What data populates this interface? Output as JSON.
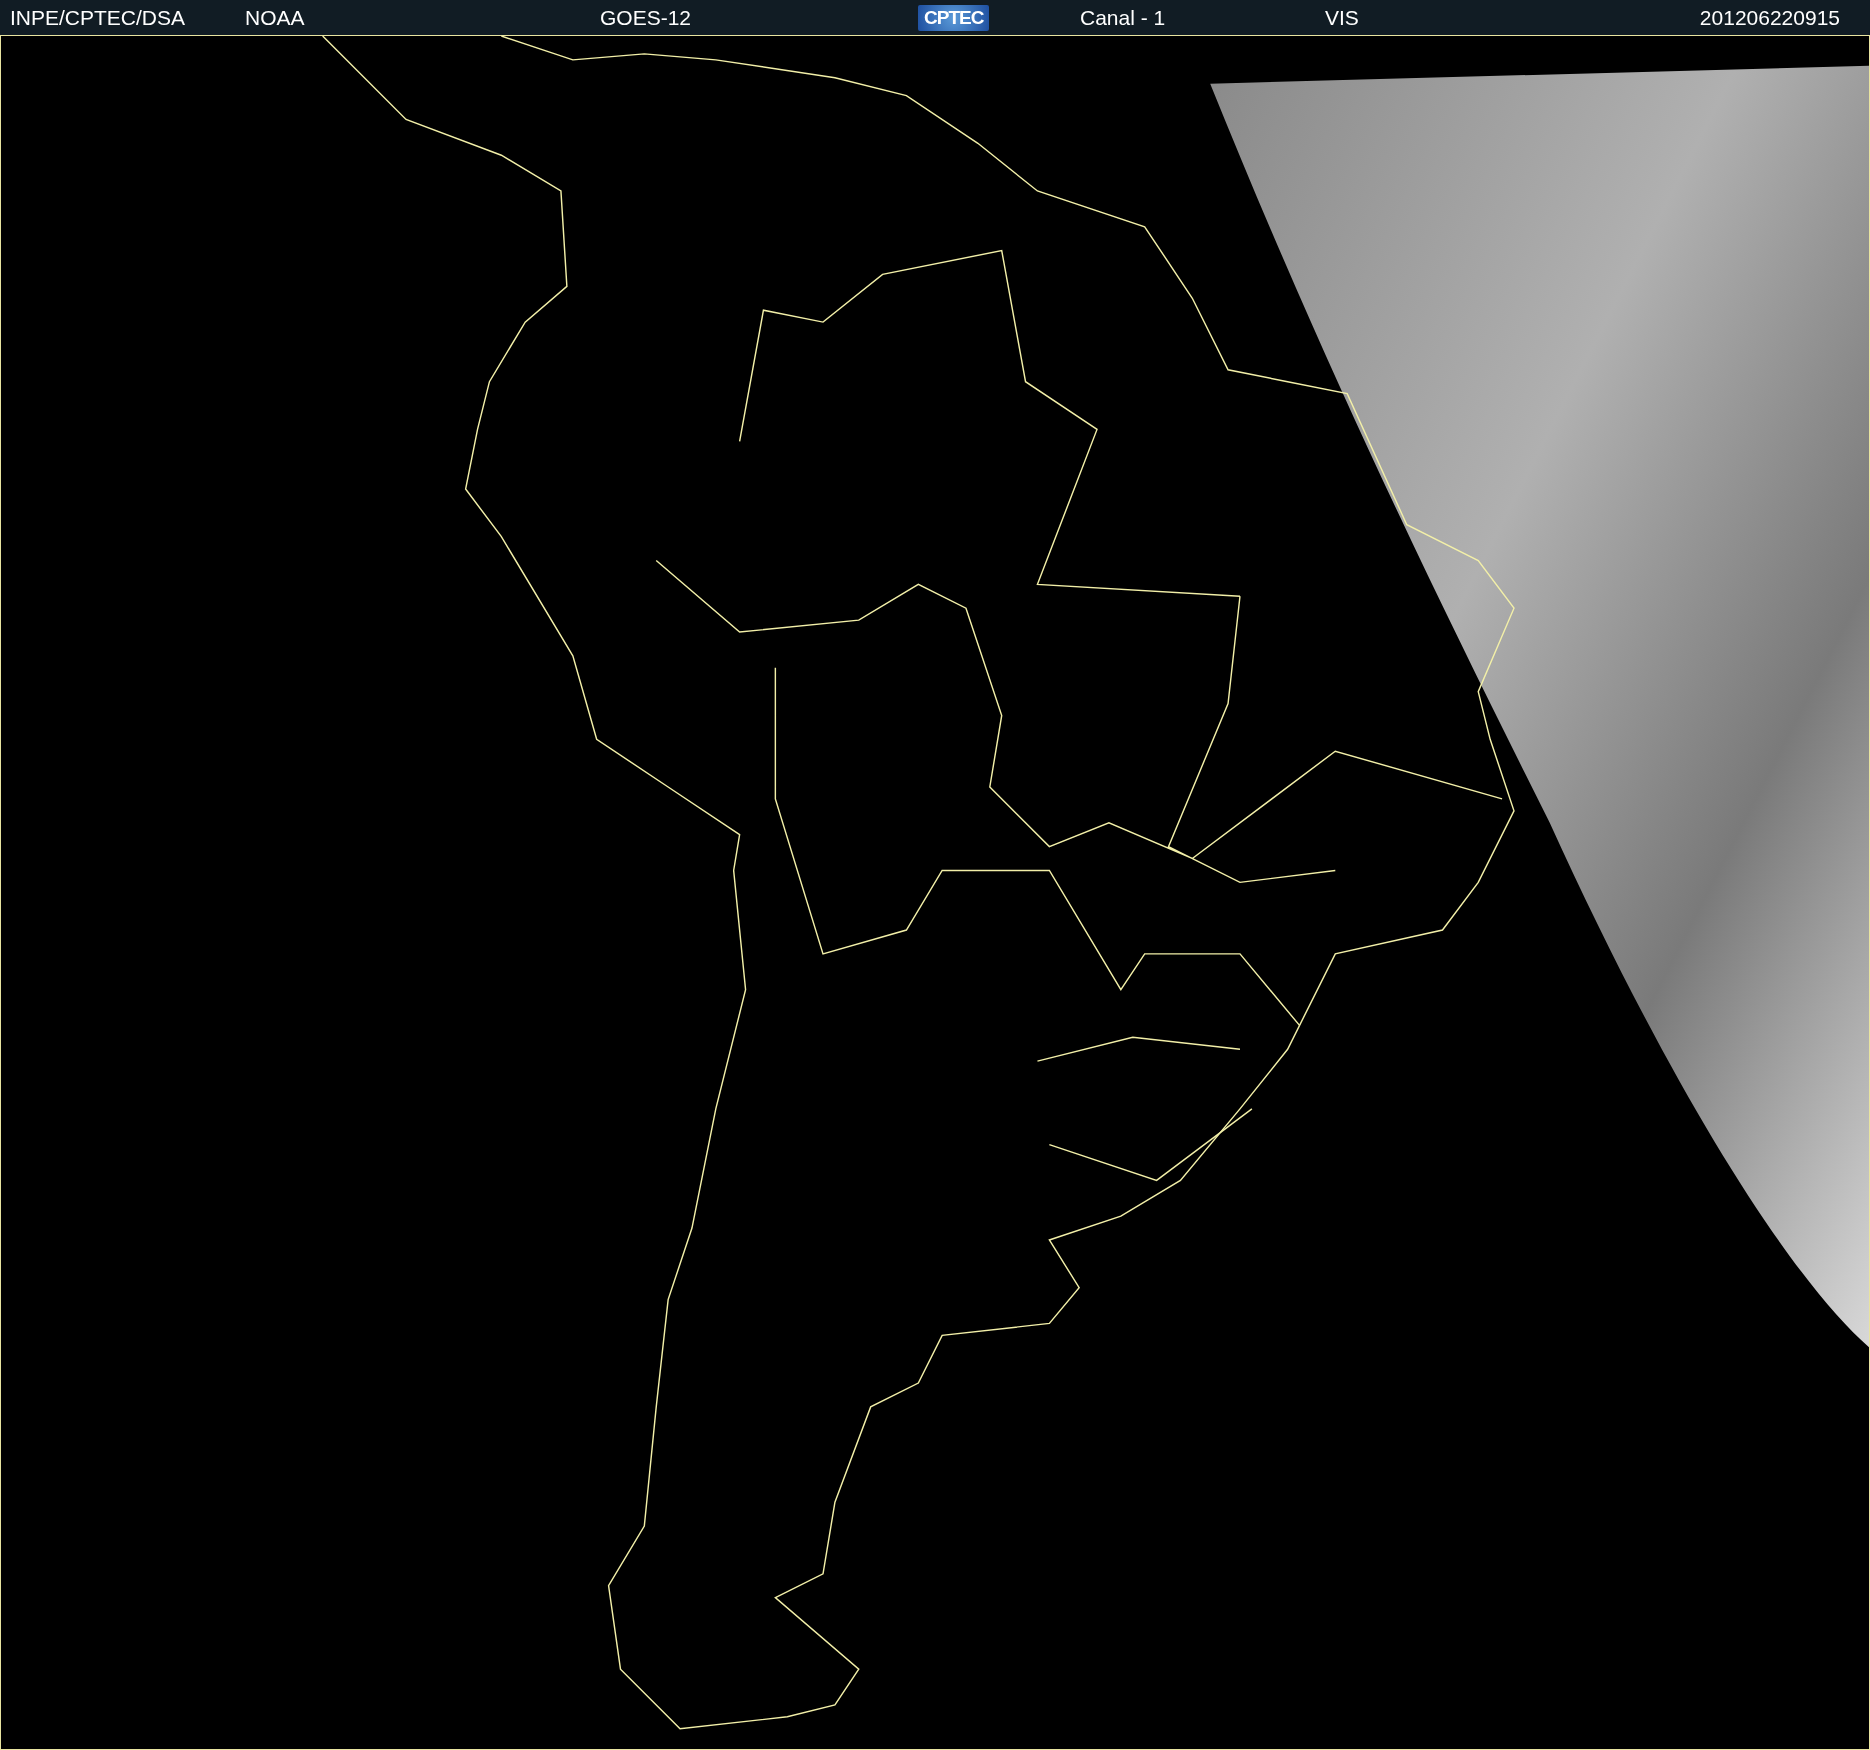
{
  "header": {
    "items": [
      {
        "kind": "text",
        "text": "INPE/CPTEC/DSA"
      },
      {
        "kind": "text",
        "text": "NOAA"
      },
      {
        "kind": "text",
        "text": "GOES-12"
      },
      {
        "kind": "logo",
        "text": "CPTEC"
      },
      {
        "kind": "text",
        "text": "Canal - 1"
      },
      {
        "kind": "text",
        "text": "VIS"
      },
      {
        "kind": "text",
        "text": "201206220915"
      }
    ]
  }
}
